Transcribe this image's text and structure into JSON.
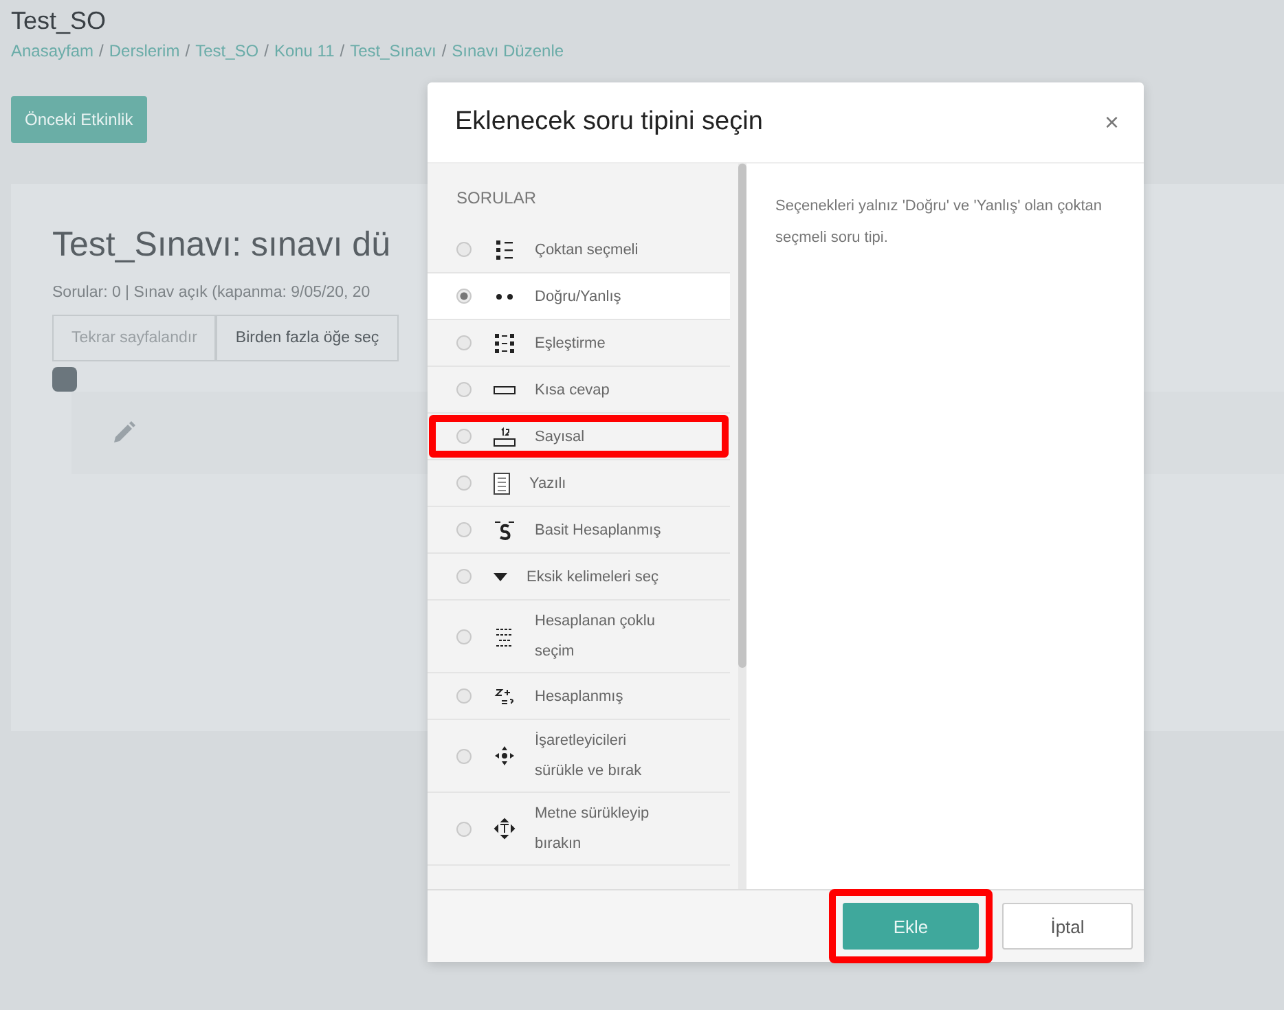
{
  "page": {
    "course_title": "Test_SO",
    "breadcrumb_separator": "/",
    "breadcrumbs": [
      "Anasayfam",
      "Derslerim",
      "Test_SO",
      "Konu 11",
      "Test_Sınavı",
      "Sınavı Düzenle"
    ],
    "prev_button": "Önceki Etkinlik",
    "heading": "Test_Sınavı: sınavı dü",
    "summary": "Sorular: 0 | Sınav açık (kapanma: 9/05/20, 20",
    "toolbar": [
      {
        "label": "Tekrar sayfalandır",
        "disabled": true
      },
      {
        "label": "Birden fazla öğe seç",
        "disabled": false
      }
    ]
  },
  "dialog": {
    "title": "Eklenecek soru tipini seçin",
    "close": "×",
    "section": "SORULAR",
    "types": [
      {
        "label": "Çoktan seçmeli",
        "kind": "multichoice",
        "selected": false,
        "highlighted": false
      },
      {
        "label": "Doğru/Yanlış",
        "kind": "truefalse",
        "selected": true,
        "highlighted": false
      },
      {
        "label": "Eşleştirme",
        "kind": "match",
        "selected": false,
        "highlighted": false
      },
      {
        "label": "Kısa cevap",
        "kind": "shortanswer",
        "selected": false,
        "highlighted": false
      },
      {
        "label": "Sayısal",
        "kind": "numerical",
        "selected": false,
        "highlighted": true
      },
      {
        "label": "Yazılı",
        "kind": "essay",
        "selected": false,
        "highlighted": false
      },
      {
        "label": "Basit Hesaplanmış",
        "kind": "calculatedsimple",
        "selected": false,
        "highlighted": false
      },
      {
        "label": "Eksik kelimeleri seç",
        "kind": "gapselect",
        "selected": false,
        "highlighted": false
      },
      {
        "label": "Hesaplanan çoklu seçim",
        "kind": "calculatedmulti",
        "selected": false,
        "highlighted": false
      },
      {
        "label": "Hesaplanmış",
        "kind": "calculated",
        "selected": false,
        "highlighted": false
      },
      {
        "label": "İşaretleyicileri sürükle ve bırak",
        "kind": "ddmarker",
        "selected": false,
        "highlighted": false
      },
      {
        "label": "Metne sürükleyip bırakın",
        "kind": "ddwtos",
        "selected": false,
        "highlighted": false
      }
    ],
    "description": "Seçenekleri yalnız 'Doğru' ve 'Yanlış' olan çoktan seçmeli soru tipi.",
    "buttons": [
      {
        "label": "Ekle",
        "kind": "primary",
        "highlighted": true
      },
      {
        "label": "İptal",
        "kind": "secondary",
        "highlighted": false
      }
    ]
  }
}
